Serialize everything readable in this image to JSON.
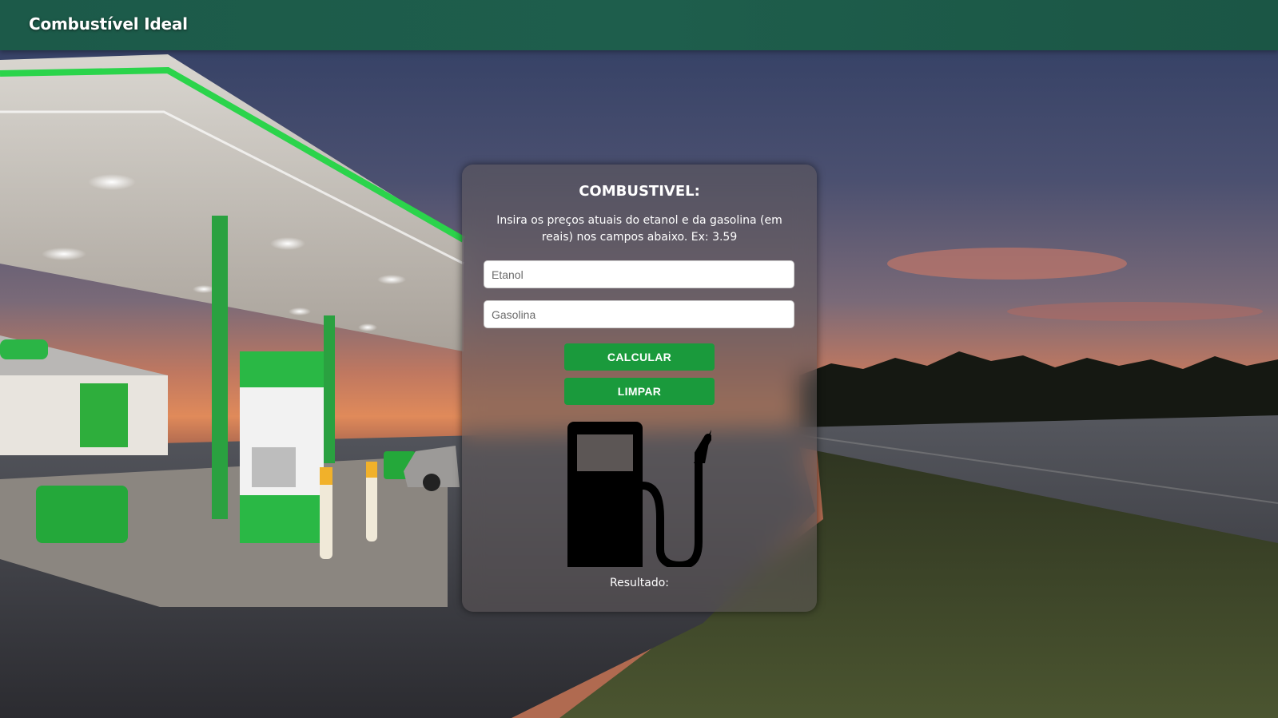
{
  "header": {
    "brand": "Combustível Ideal"
  },
  "card": {
    "title": "COMBUSTIVEL:",
    "description": "Insira os preços atuais do etanol e da gasolina (em reais) nos campos abaixo. Ex: 3.59",
    "etanol_placeholder": "Etanol",
    "etanol_value": "",
    "gasolina_placeholder": "Gasolina",
    "gasolina_value": "",
    "calcular_label": "CALCULAR",
    "limpar_label": "LIMPAR",
    "pump_icon": "fuel-pump-icon",
    "result_label": "Resultado:"
  },
  "colors": {
    "header": "#1e5e4c",
    "button": "#1a9a3c",
    "station_green": "#2bc443"
  }
}
